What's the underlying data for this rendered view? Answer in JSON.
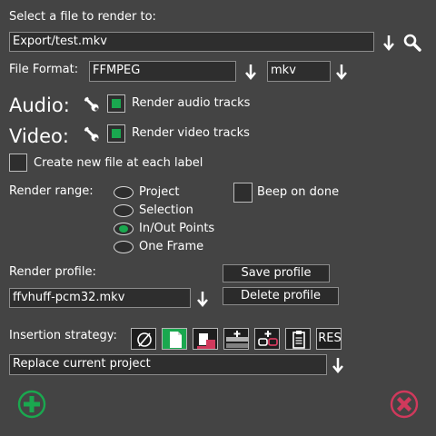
{
  "file": {
    "prompt": "Select a file to render to:",
    "path": "Export/test.mkv"
  },
  "format": {
    "label": "File Format:",
    "value": "FFMPEG",
    "extension": "mkv"
  },
  "audio": {
    "label": "Audio:",
    "checkbox_label": "Render audio tracks",
    "checked": true
  },
  "video": {
    "label": "Video:",
    "checkbox_label": "Render video tracks",
    "checked": true
  },
  "new_file_per_label": {
    "label": "Create new file at each label",
    "checked": false
  },
  "render_range": {
    "label": "Render range:",
    "options": [
      "Project",
      "Selection",
      "In/Out Points",
      "One Frame"
    ],
    "selected": "In/Out Points"
  },
  "beep": {
    "label": "Beep on done",
    "checked": false
  },
  "profile": {
    "label": "Render profile:",
    "value": "ffvhuff-pcm32.mkv",
    "save_label": "Save profile",
    "delete_label": "Delete profile"
  },
  "insertion": {
    "label": "Insertion strategy:",
    "icons": [
      "no-insert-icon",
      "new-file-icon",
      "insert-media-icon",
      "paste-tracks-icon",
      "link-paste-icon",
      "clipboard-icon",
      "resource-icon"
    ],
    "selected_index": 1,
    "res_text": "RES",
    "strategy_value": "Replace current project"
  },
  "colors": {
    "background": "#444444",
    "accent_green": "#1aa84f",
    "cancel_red": "#d0395c"
  },
  "actions": {
    "ok_icon": "plus-circle-icon",
    "cancel_icon": "x-circle-icon"
  }
}
